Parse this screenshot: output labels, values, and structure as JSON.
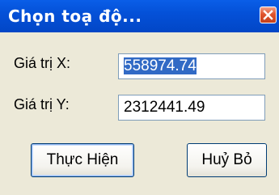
{
  "window": {
    "title": "Chọn toạ độ..."
  },
  "form": {
    "x_label": "Giá trị X:",
    "x_value": "558974.74",
    "y_label": "Giá trị Y:",
    "y_value": "2312441.49"
  },
  "buttons": {
    "ok_label": "Thực Hiện",
    "cancel_label": "Huỷ Bỏ"
  },
  "icons": {
    "close": "close-icon"
  },
  "colors": {
    "titlebar": "#0451d8",
    "close_button": "#e0542c",
    "selection": "#316ac5",
    "dialog_bg": "#ece9d8"
  }
}
